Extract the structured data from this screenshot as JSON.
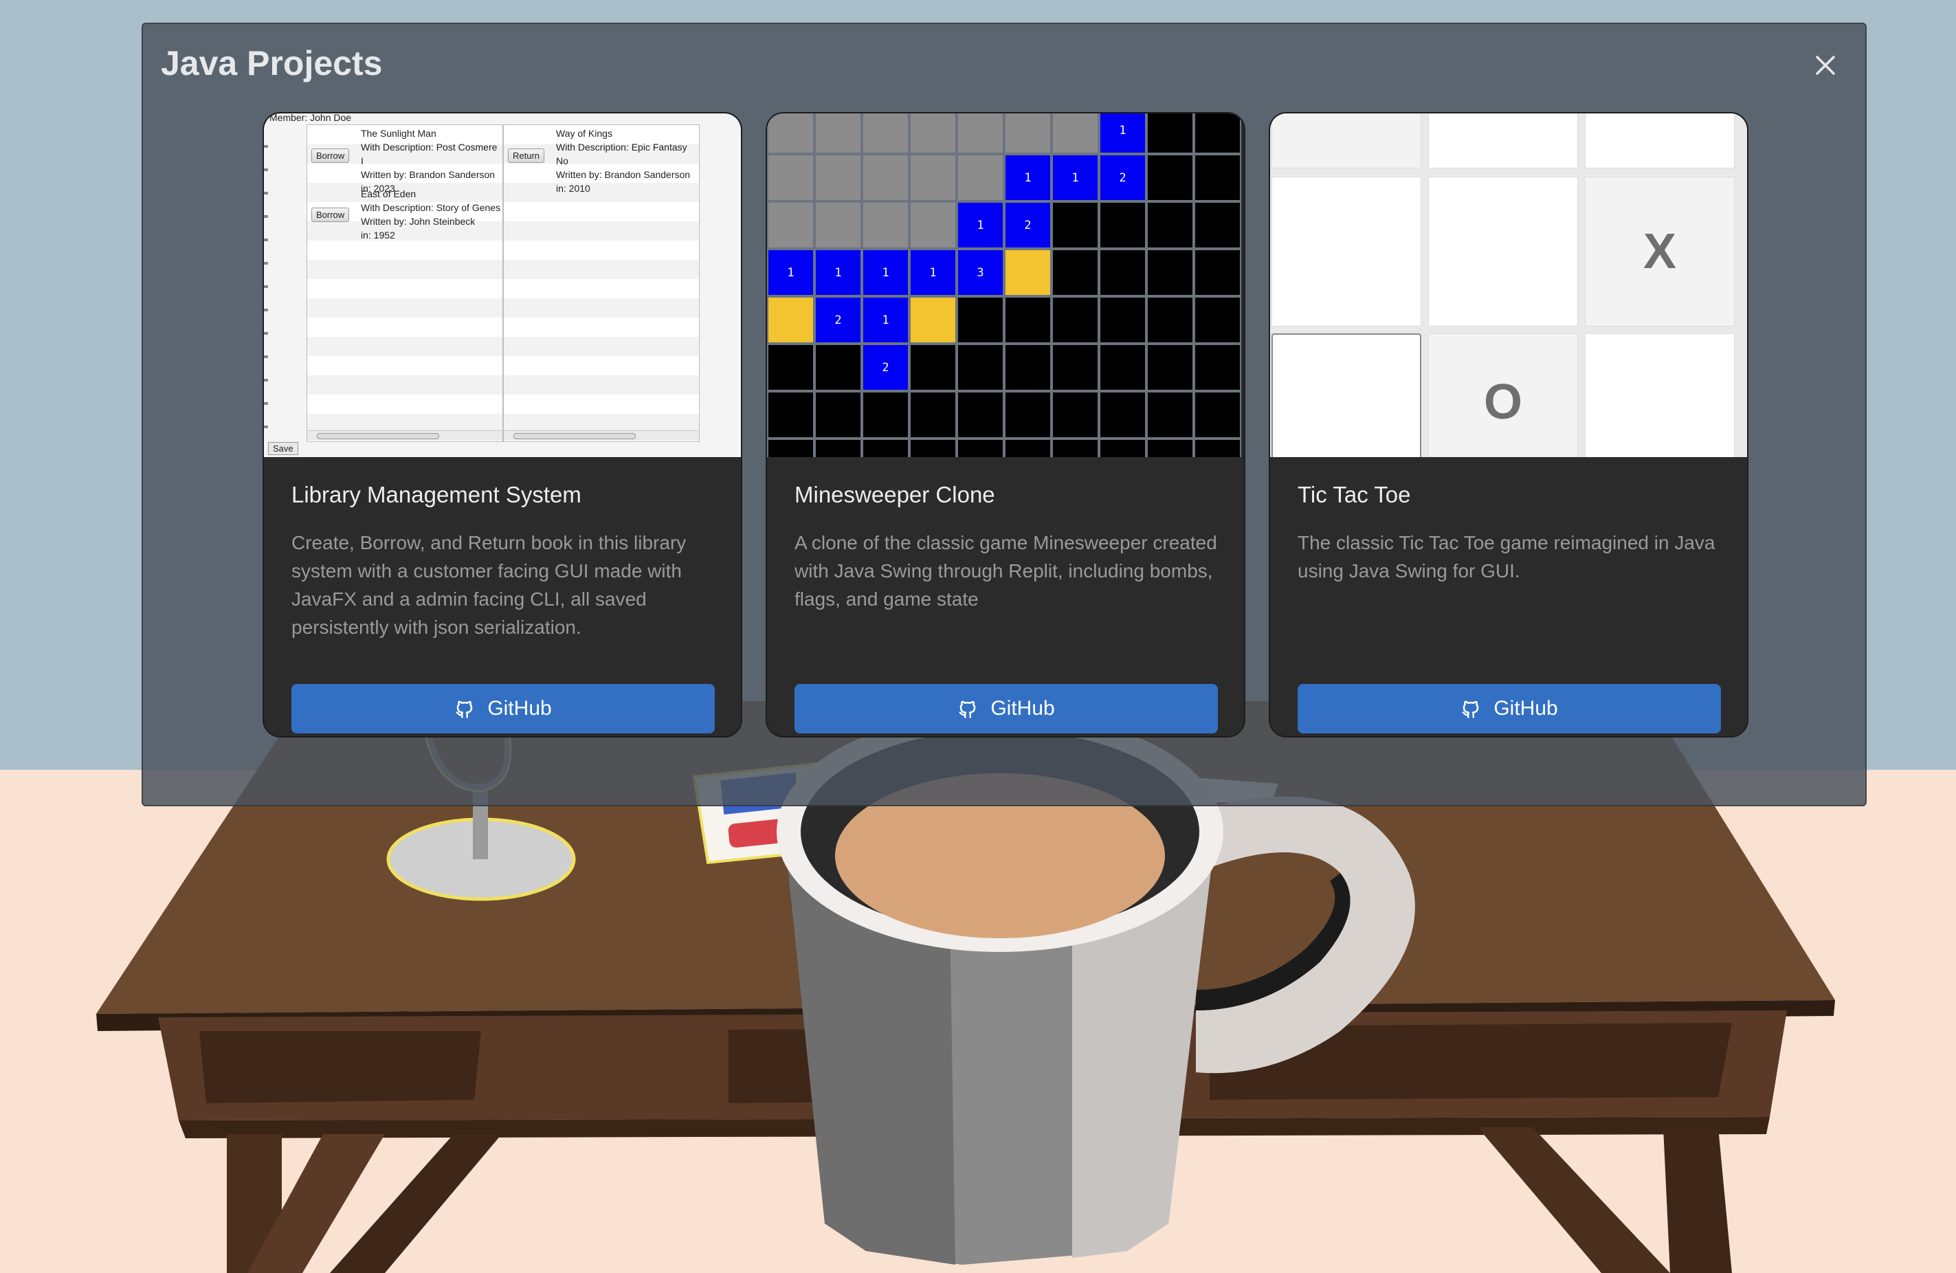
{
  "modal": {
    "title": "Java Projects",
    "close_icon": "close-icon"
  },
  "cards": [
    {
      "title": "Library Management System",
      "description": "Create, Borrow, and Return book in this library system with a customer facing GUI made with JavaFX and a admin facing CLI, all saved persistently with json serialization.",
      "button_label": "GitHub",
      "button_icon": "github-icon",
      "preview": {
        "member": "Member: John Doe",
        "left_books": [
          {
            "button": "Borrow",
            "lines": [
              "The Sunlight Man",
              "With Description: Post Cosmere I",
              "Written by: Brandon Sanderson",
              "in: 2023"
            ]
          },
          {
            "button": "Borrow",
            "lines": [
              "East of Eden",
              "With Description: Story of Genes",
              "Written by: John Steinbeck",
              "in: 1952"
            ]
          }
        ],
        "right_books": [
          {
            "button": "Return",
            "lines": [
              "Way of Kings",
              "With Description: Epic Fantasy No",
              "Written by: Brandon Sanderson",
              "in: 2010"
            ]
          }
        ],
        "save_label": "Save"
      }
    },
    {
      "title": "Minesweeper Clone",
      "description": "A clone of the classic game Minesweeper created with Java Swing through Replit, including bombs, flags, and game state",
      "button_label": "GitHub",
      "button_icon": "github-icon",
      "preview": {
        "rows": [
          [
            "g",
            "g",
            "g",
            "g",
            "g",
            "g",
            "g",
            "1",
            "b",
            "b"
          ],
          [
            "g",
            "g",
            "g",
            "g",
            "g",
            "1",
            "1",
            "2",
            "b",
            "b"
          ],
          [
            "g",
            "g",
            "g",
            "g",
            "1",
            "2",
            "b",
            "b",
            "b",
            "b"
          ],
          [
            "1",
            "1",
            "1",
            "1",
            "3",
            "y",
            "b",
            "b",
            "b",
            "b"
          ],
          [
            "y",
            "2",
            "1",
            "y",
            "b",
            "b",
            "b",
            "b",
            "b",
            "b"
          ],
          [
            "b",
            "b",
            "2",
            "b",
            "b",
            "b",
            "b",
            "b",
            "b",
            "b"
          ],
          [
            "b",
            "b",
            "b",
            "b",
            "b",
            "b",
            "b",
            "b",
            "b",
            "b"
          ],
          [
            "b",
            "b",
            "b",
            "b",
            "b",
            "b",
            "b",
            "b",
            "b",
            "b"
          ]
        ]
      }
    },
    {
      "title": "Tic Tac Toe",
      "description": "The classic Tic Tac Toe game reimagined in Java using Java Swing for GUI.",
      "button_label": "GitHub",
      "button_icon": "github-icon",
      "preview": {
        "cells": [
          "",
          "",
          "",
          "",
          "",
          "X",
          "",
          "O",
          ""
        ]
      }
    }
  ],
  "colors": {
    "button": "#3370c3",
    "card": "#2b2b2b",
    "mine_number": "#0000f5",
    "mine_flag": "#f4c430"
  }
}
